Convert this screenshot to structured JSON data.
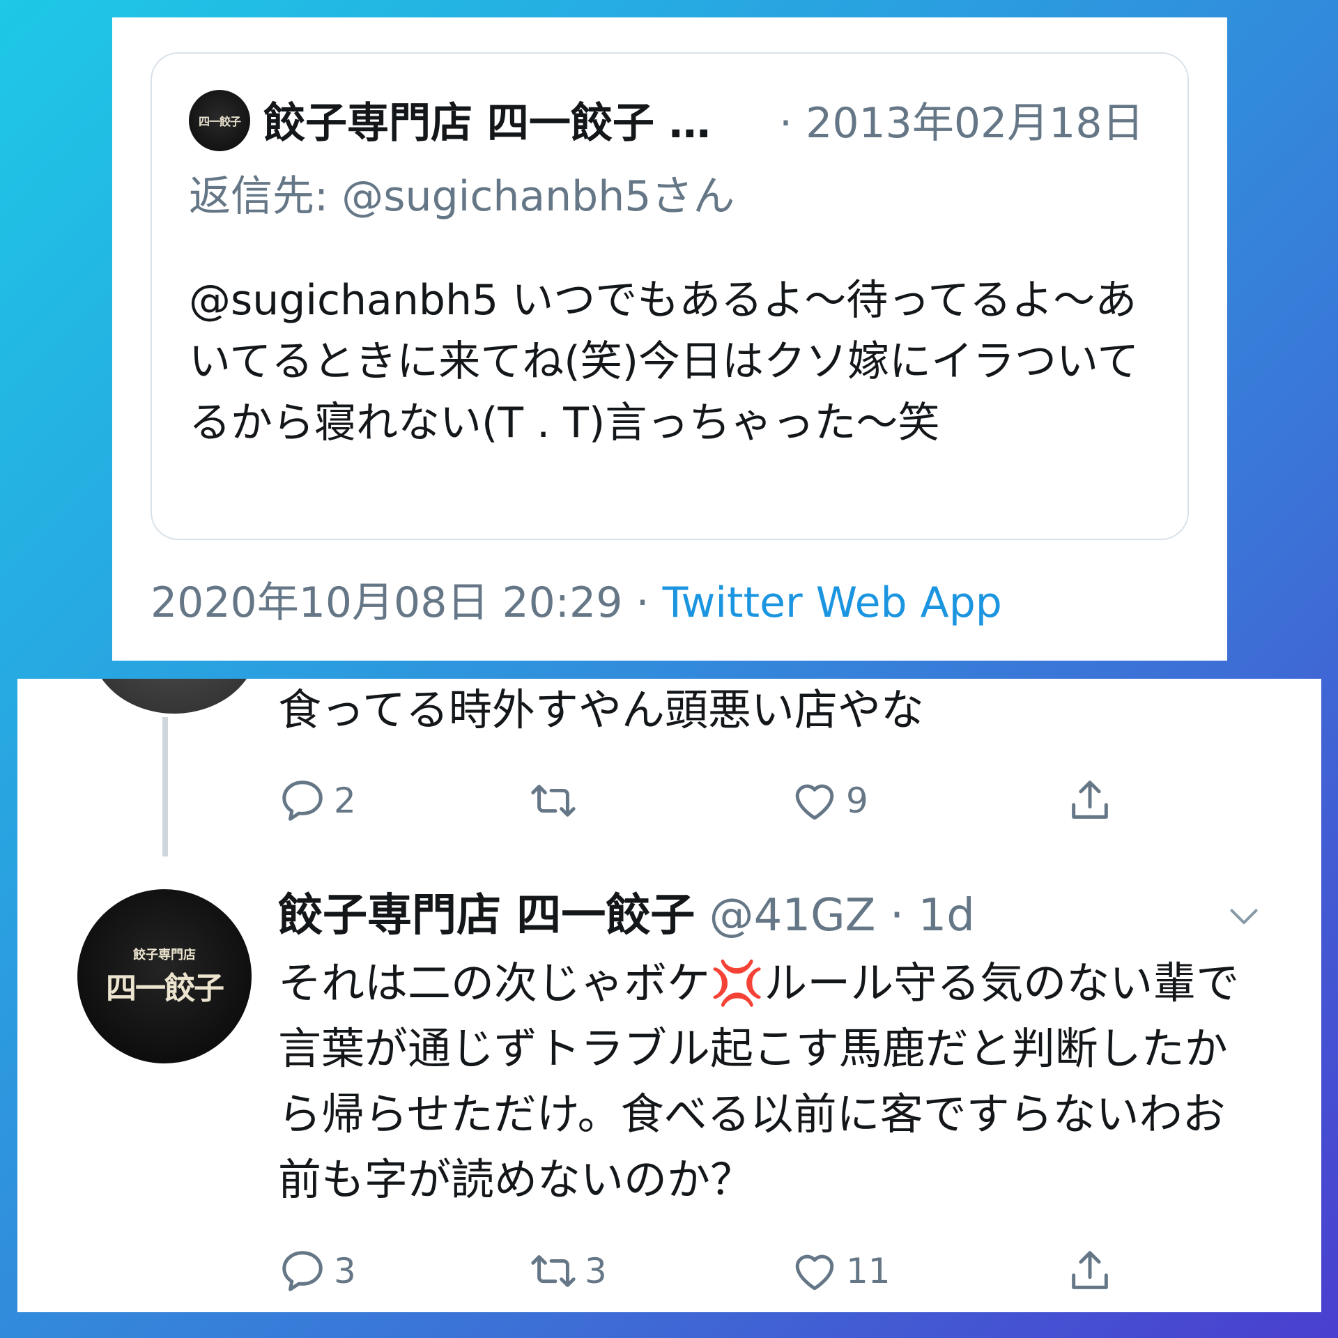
{
  "quote": {
    "avatar_label": "四一餃子",
    "name": "餃子専門店 四一餃子 …",
    "date": "· 2013年02月18日",
    "reply_to": "返信先: @sugichanbh5さん",
    "text": "@sugichanbh5 いつでもあるよ～待ってるよ～あいてるときに来てね(笑)今日はクソ嫁にイラついてるから寝れない(T . T)言っちゃった～笑"
  },
  "meta": {
    "timestamp": "2020年10月08日 20:29",
    "separator": " · ",
    "source": "Twitter Web App"
  },
  "prev_tweet": {
    "text": "食ってる時外すやん頭悪い店やな",
    "reply_count": "2",
    "retweet_count": "",
    "like_count": "9"
  },
  "tweet": {
    "avatar_line1": "餃子専門店",
    "avatar_line2": "四一餃子",
    "name": "餃子専門店 四一餃子",
    "handle": " @41GZ · 1d",
    "text_before_emoji": "それは二の次じゃボケ",
    "emoji": "💢",
    "text_after_emoji": "ルール守る気のない輩で言葉が通じずトラブル起こす馬鹿だと判断したから帰らせただけ。食べる以前に客ですらないわお前も字が読めないのか？",
    "reply_count": "3",
    "retweet_count": "3",
    "like_count": "11"
  },
  "colors": {
    "text": "#14171a",
    "muted": "#657786",
    "link": "#1b95e0",
    "border": "#d9e1e8"
  },
  "icons": [
    "reply-icon",
    "retweet-icon",
    "like-icon",
    "share-icon",
    "chevron-down-icon"
  ]
}
